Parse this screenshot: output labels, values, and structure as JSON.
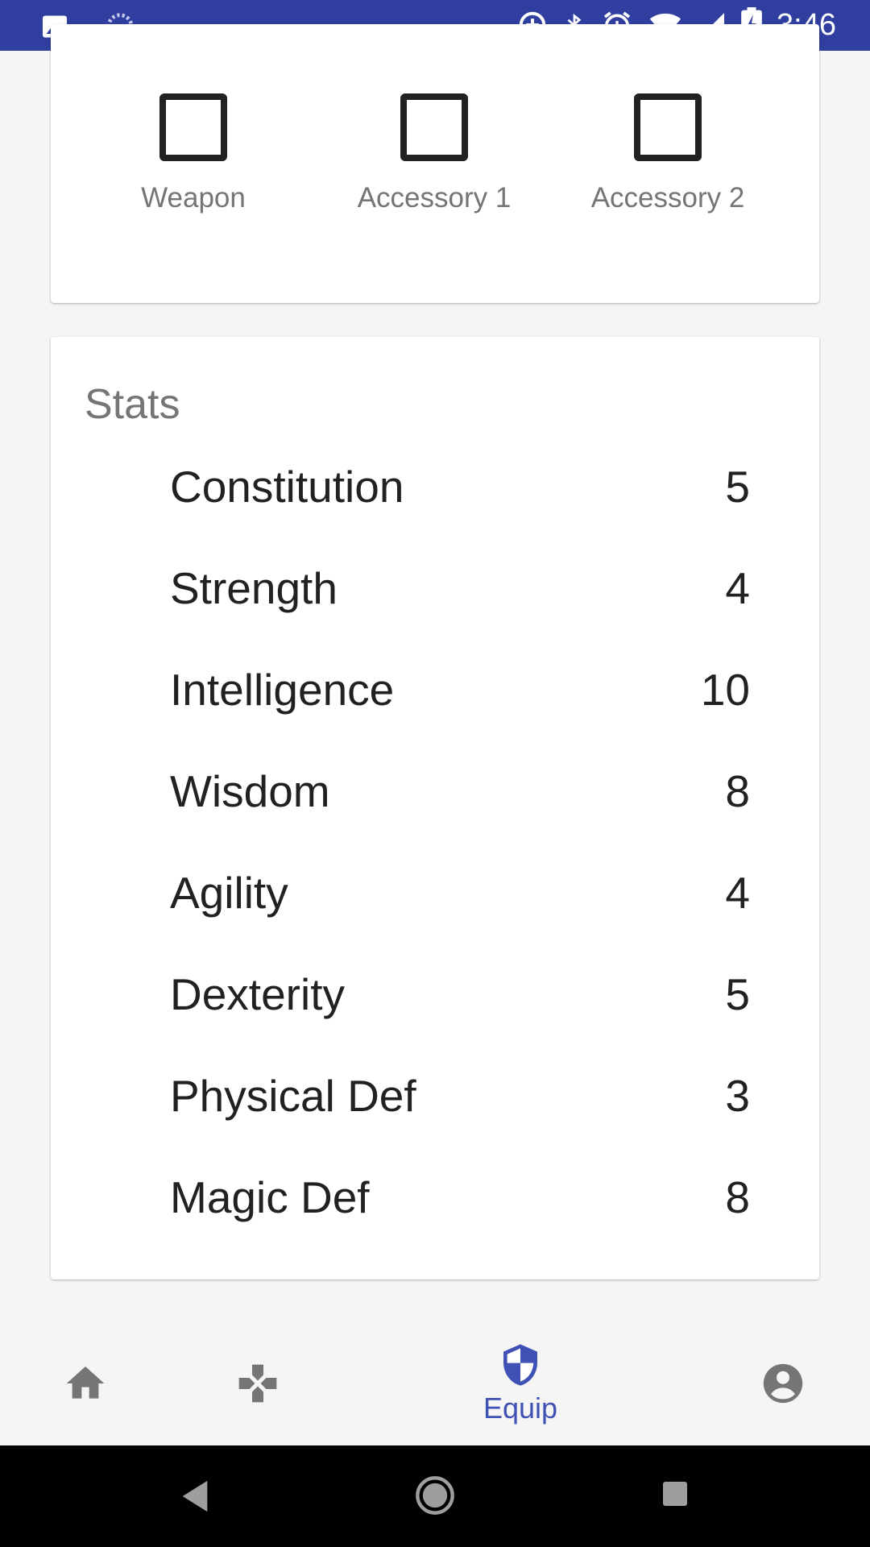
{
  "status_bar": {
    "time": "3:46",
    "left_icons": [
      "image-icon",
      "sync-icon"
    ],
    "right_icons": [
      "data-saver-icon",
      "bluetooth-icon",
      "alarm-icon",
      "wifi-icon",
      "cell-signal-icon",
      "battery-charging-icon"
    ],
    "background": "#303f9f"
  },
  "equipment": {
    "slots": [
      {
        "label": "Weapon"
      },
      {
        "label": "Accessory 1"
      },
      {
        "label": "Accessory 2"
      }
    ]
  },
  "stats": {
    "title": "Stats",
    "rows": [
      {
        "name": "Constitution",
        "value": "5"
      },
      {
        "name": "Strength",
        "value": "4"
      },
      {
        "name": "Intelligence",
        "value": "10"
      },
      {
        "name": "Wisdom",
        "value": "8"
      },
      {
        "name": "Agility",
        "value": "4"
      },
      {
        "name": "Dexterity",
        "value": "5"
      },
      {
        "name": "Physical Def",
        "value": "3"
      },
      {
        "name": "Magic Def",
        "value": "8"
      }
    ]
  },
  "bottom_nav": {
    "items": [
      {
        "icon": "home-icon",
        "label": ""
      },
      {
        "icon": "gamepad-icon",
        "label": ""
      },
      {
        "icon": "shield-icon",
        "label": "Equip",
        "active": true
      },
      {
        "icon": "account-circle-icon",
        "label": ""
      }
    ],
    "active_color": "#3f51b5",
    "inactive_color": "#757575"
  },
  "system_nav": {
    "buttons": [
      "back-icon",
      "home-circle-icon",
      "recents-icon"
    ]
  }
}
